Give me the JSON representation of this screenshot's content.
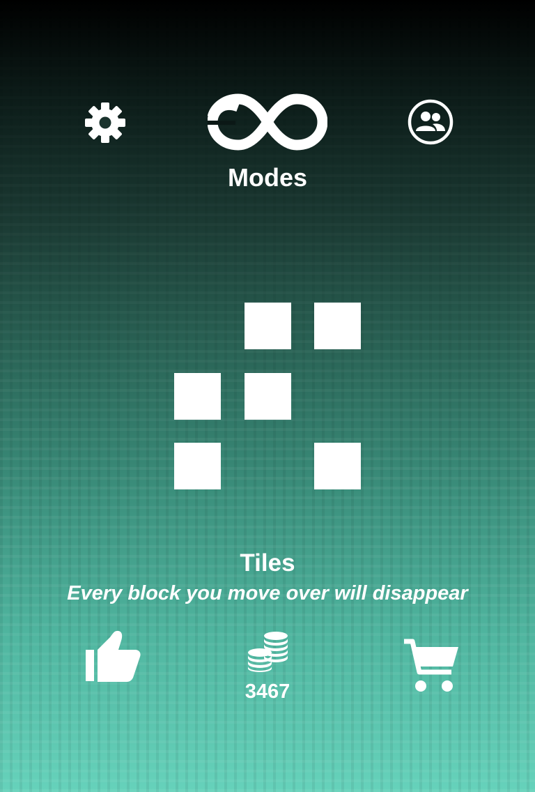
{
  "header": {
    "settings_icon": "gear-icon",
    "modes_icon": "infinity-icon",
    "modes_label": "Modes",
    "social_icon": "people-circle-icon"
  },
  "preview": {
    "tile_color": "#ffffff",
    "tiles": [
      {
        "row": 0,
        "col": 1
      },
      {
        "row": 0,
        "col": 2
      },
      {
        "row": 1,
        "col": 0
      },
      {
        "row": 1,
        "col": 1
      },
      {
        "row": 2,
        "col": 0
      },
      {
        "row": 2,
        "col": 2
      }
    ]
  },
  "game": {
    "name": "Tiles",
    "description": "Every block you move over will disappear"
  },
  "footer": {
    "like_icon": "thumbs-up-icon",
    "coins_icon": "coin-stack-icon",
    "coins": "3467",
    "shop_icon": "cart-icon"
  },
  "colors": {
    "background_top": "#000000",
    "background_bottom": "#66d2bb",
    "foreground": "#ffffff"
  }
}
